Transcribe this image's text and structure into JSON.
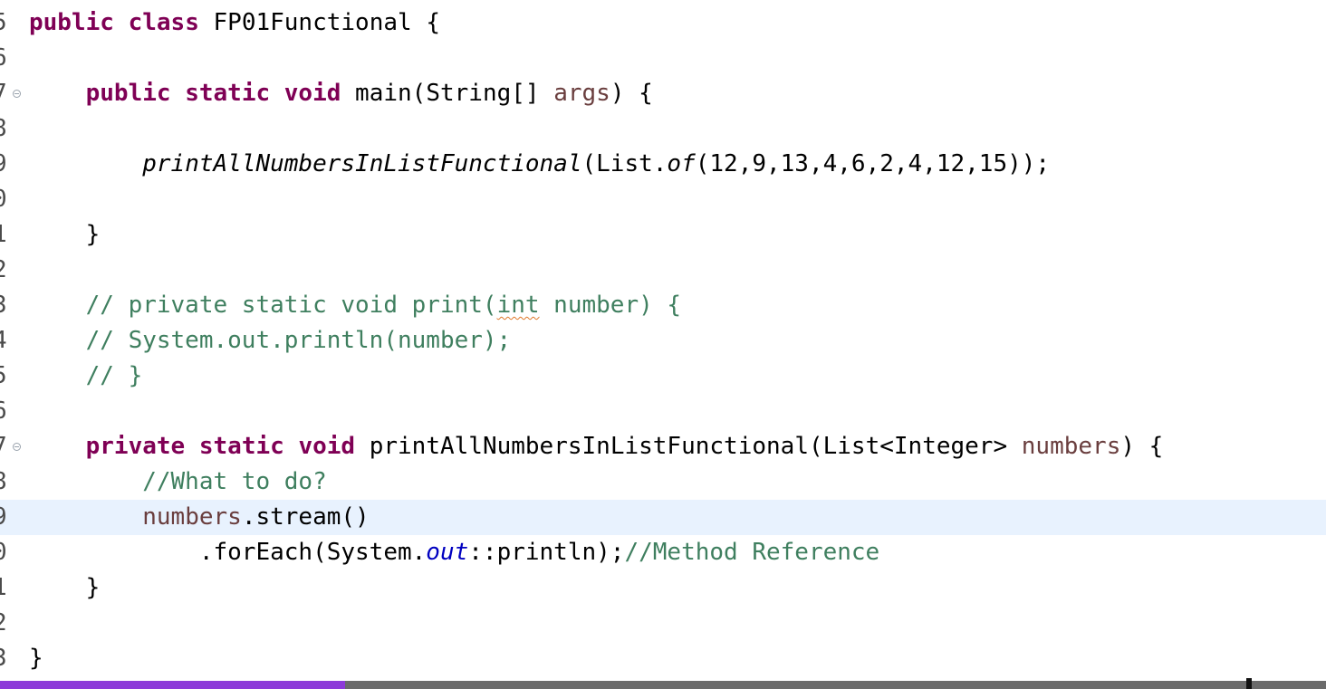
{
  "editor": {
    "highlighted_line": "19",
    "lines": [
      {
        "n": "5",
        "code": "public class FP01Functional {"
      },
      {
        "n": "6",
        "code": ""
      },
      {
        "n": "7",
        "code": "    public static void main(String[] args) {"
      },
      {
        "n": "8",
        "code": ""
      },
      {
        "n": "9",
        "code": "        printAllNumbersInListFunctional(List.of(12,9,13,4,6,2,4,12,15));"
      },
      {
        "n": "0",
        "code": ""
      },
      {
        "n": "1",
        "code": "    }"
      },
      {
        "n": "2",
        "code": ""
      },
      {
        "n": "3",
        "code": "    // private static void print(int number) {"
      },
      {
        "n": "4",
        "code": "    // System.out.println(number);"
      },
      {
        "n": "5",
        "code": "    // }"
      },
      {
        "n": "6",
        "code": ""
      },
      {
        "n": "7",
        "code": "    private static void printAllNumbersInListFunctional(List<Integer> numbers) {"
      },
      {
        "n": "8",
        "code": "        //What to do?"
      },
      {
        "n": "9",
        "code": "        numbers.stream()"
      },
      {
        "n": "0",
        "code": "            .forEach(System.out::println);//Method Reference"
      },
      {
        "n": "1",
        "code": "    }"
      },
      {
        "n": "2",
        "code": ""
      },
      {
        "n": "3",
        "code": "}"
      }
    ]
  },
  "colors": {
    "keyword": "#7f0055",
    "comment": "#3f7f5f",
    "parameter": "#6a3e3e",
    "static_field": "#0000c0",
    "current_line_bg": "#e8f2fe",
    "progress_played": "#8d3bd9",
    "progress_track": "#6b6b6b"
  },
  "video_progress": {
    "played_fraction": 0.26,
    "handle_fraction": 0.94
  }
}
